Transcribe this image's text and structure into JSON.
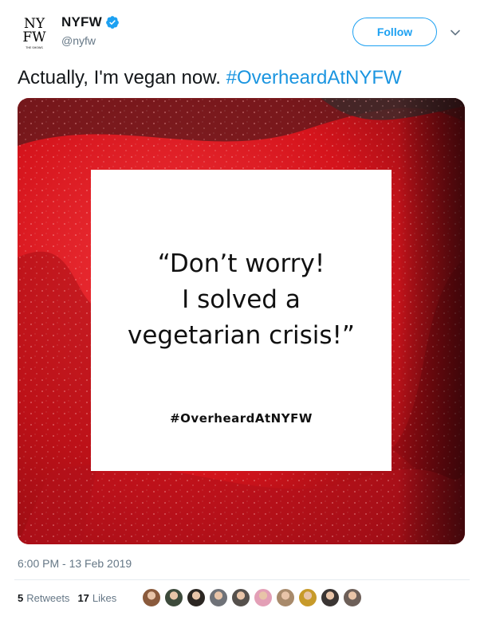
{
  "account": {
    "display_name": "NYFW",
    "handle": "@nyfw",
    "logo_text": "NY FW",
    "logo_small": "THE SHOWS",
    "verified_icon": "verified-badge-icon"
  },
  "follow_button": {
    "label": "Follow"
  },
  "menu_icon": "chevron-down-icon",
  "tweet": {
    "text": "Actually, I'm vegan now. ",
    "hashtag": "#OverheardAtNYFW"
  },
  "media": {
    "quote_line1": "“Don’t worry!",
    "quote_line2": "I solved a",
    "quote_line3": "vegetarian crisis!”",
    "tag": "#OverheardAtNYFW",
    "bg_color": "#d8141c"
  },
  "timestamp": "6:00 PM - 13 Feb 2019",
  "stats": {
    "retweets_count": "5",
    "retweets_label": "Retweets",
    "likes_count": "17",
    "likes_label": "Likes"
  },
  "likers": [
    {
      "color": "#8a5a3c"
    },
    {
      "color": "#3d4a3b"
    },
    {
      "color": "#2b2622"
    },
    {
      "color": "#6f7278"
    },
    {
      "color": "#55504c"
    },
    {
      "color": "#e39fb6"
    },
    {
      "color": "#a88a6b"
    },
    {
      "color": "#c79a2a"
    },
    {
      "color": "#3a3533"
    },
    {
      "color": "#6d5f58"
    }
  ],
  "colors": {
    "accent": "#1da1f2",
    "link": "#1b95e0",
    "muted": "#657786"
  }
}
